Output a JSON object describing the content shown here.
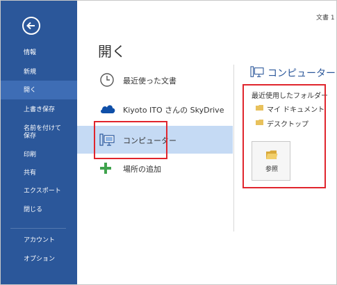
{
  "window": {
    "doc_title": "文書 1 -"
  },
  "sidebar": {
    "items": [
      {
        "label": "情報"
      },
      {
        "label": "新規"
      },
      {
        "label": "開く"
      },
      {
        "label": "上書き保存"
      },
      {
        "label": "名前を付けて"
      },
      {
        "label": "保存"
      },
      {
        "label": "印刷"
      },
      {
        "label": "共有"
      },
      {
        "label": "エクスポート"
      },
      {
        "label": "閉じる"
      },
      {
        "label": "アカウント"
      },
      {
        "label": "オプション"
      }
    ]
  },
  "main": {
    "title": "開く",
    "places": [
      {
        "label": "最近使った文書",
        "icon": "clock-icon"
      },
      {
        "label": "Kiyoto ITO さんの SkyDrive",
        "icon": "cloud-icon"
      },
      {
        "label": "コンピューター",
        "icon": "computer-icon",
        "selected": true
      },
      {
        "label": "場所の追加",
        "icon": "plus-icon"
      }
    ]
  },
  "right_panel": {
    "header": "コンピューター",
    "recent_folders_label": "最近使用したフォルダー",
    "folders": [
      {
        "label": "マイ ドキュメント"
      },
      {
        "label": "デスクトップ"
      }
    ],
    "browse_label": "参照"
  },
  "colors": {
    "sidebar": "#2b579a",
    "sidebar_active": "#3e6db5",
    "selected_place": "#c5daf4",
    "highlight": "#e0242c",
    "folder": "#e8c15c"
  }
}
